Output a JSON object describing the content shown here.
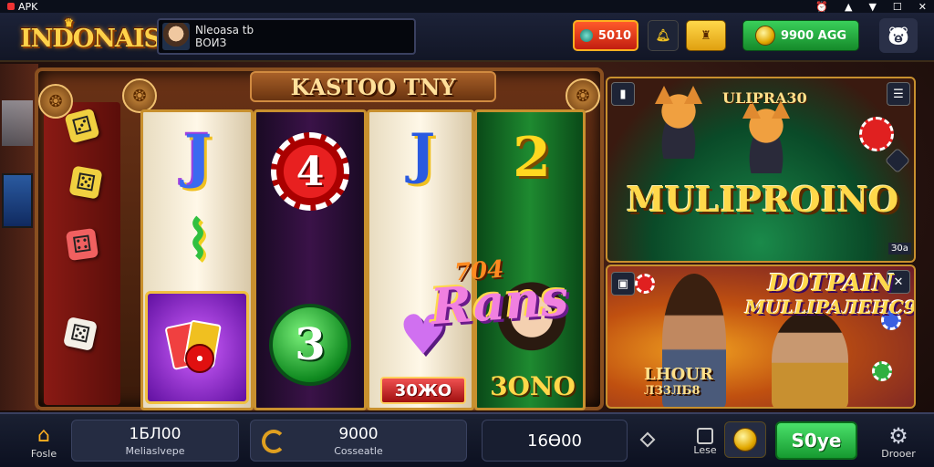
{
  "status_bar": {
    "app_label": "APK",
    "icons": [
      "alarm-icon",
      "signal-icon",
      "wifi-icon",
      "window-icon",
      "close-icon"
    ]
  },
  "header": {
    "logo_text": "INDONAIS",
    "profile": {
      "name": "Nleoasa tb",
      "sub": "ВОИЗ"
    },
    "red_button_value": "5010",
    "green_button_value": "9900 AGG",
    "icons": [
      "chip-icon",
      "bell-icon",
      "trophy-icon",
      "coin-icon",
      "mascot-icon"
    ]
  },
  "machine": {
    "title": "KASTOO TNY",
    "reels": [
      {
        "top": "J",
        "mid": "swoosh",
        "bottom": "cards"
      },
      {
        "top": "4",
        "bottom": "3"
      },
      {
        "top": "J",
        "bottom": "heart",
        "tag": "30ЖO"
      },
      {
        "top": "2",
        "bottom": "3ONO"
      }
    ],
    "overlay_top": "704",
    "overlay_main": "Rans"
  },
  "panels": {
    "multiplayer": {
      "subtitle": "ULIPRA30",
      "title": "MULIPROINO",
      "corner": "З0а"
    },
    "promo": {
      "title_line1": "DOTPAIN",
      "title_line2": "MULLIPAЛЕНС9",
      "badge_line1": "LHOUR",
      "badge_line2": "ЛЗ3ЛБ8"
    }
  },
  "bottom_bar": {
    "home_label": "Fosle",
    "balance_value": "1БЛ00",
    "balance_label": "Меliaslvepe",
    "win_value": "9000",
    "win_label": "Сosseatle",
    "bet_value": "16Ө00",
    "dots_label": "Lese",
    "spin_label": "S0ye",
    "settings_label": "Drooer"
  },
  "colors": {
    "gold": "#ffd84a",
    "spin_green": "#2ab84a",
    "accent_red": "#e02020"
  }
}
